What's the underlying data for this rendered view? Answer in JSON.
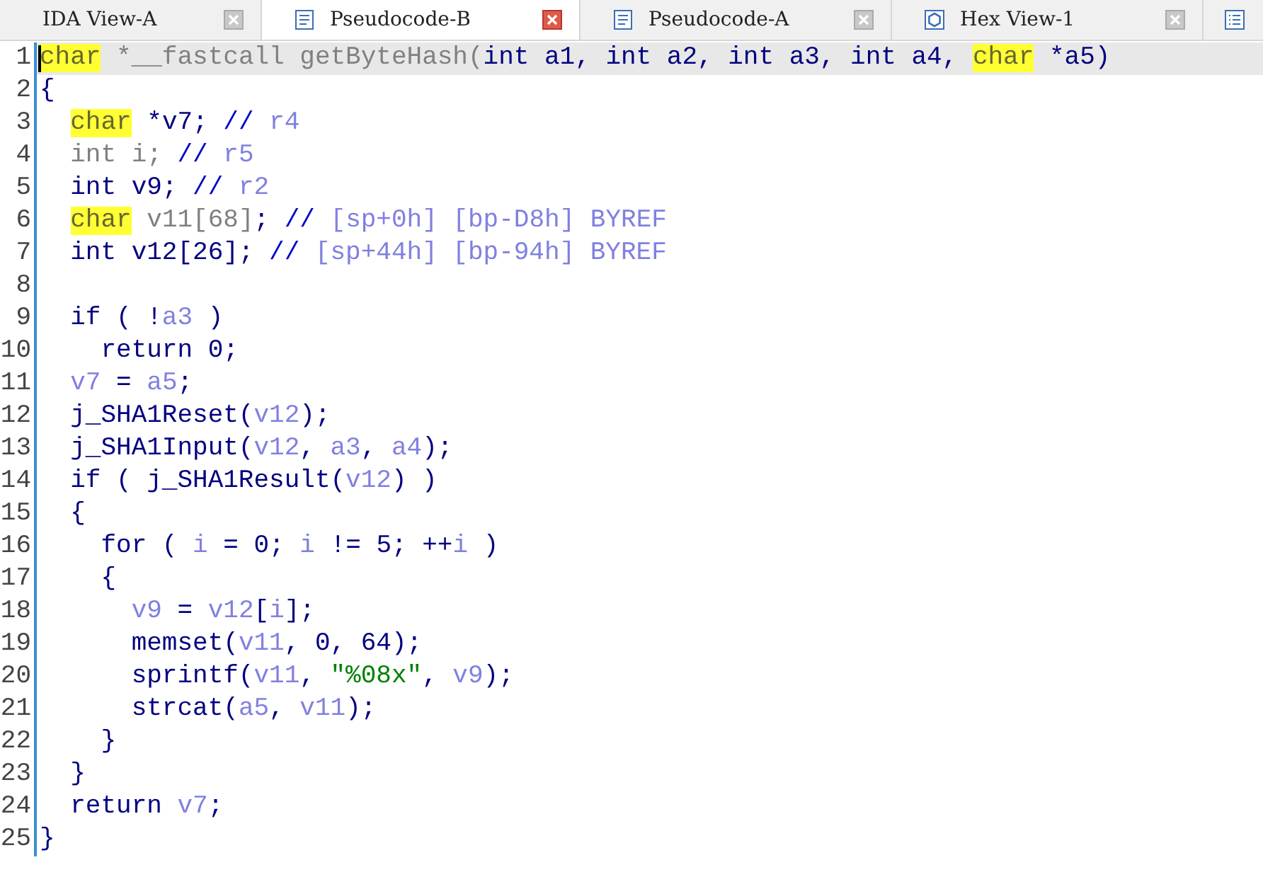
{
  "tabs": [
    {
      "label": "IDA View-A",
      "kind": "disassembly",
      "selected": false
    },
    {
      "label": "Pseudocode-B",
      "kind": "pseudocode",
      "selected": true
    },
    {
      "label": "Pseudocode-A",
      "kind": "pseudocode",
      "selected": false
    },
    {
      "label": "Hex View-1",
      "kind": "hex",
      "selected": false
    },
    {
      "kind": "structures",
      "selected": false
    }
  ],
  "lines": [
    {
      "number": "1",
      "current": true,
      "tokens": [
        {
          "text": "char",
          "kind": "highlight"
        },
        {
          "text": " *__fastcall getByteHash(",
          "kind": "dim"
        },
        {
          "text": "int a1, int a2, int a3, int a4, ",
          "kind": "code"
        },
        {
          "text": "char",
          "kind": "highlight"
        },
        {
          "text": " *a5)",
          "kind": "code"
        }
      ]
    },
    {
      "number": "2",
      "current": false,
      "tokens": [
        {
          "text": "{",
          "kind": "code"
        }
      ]
    },
    {
      "number": "3",
      "current": false,
      "tokens": [
        {
          "text": "  char",
          "kind": "highlight"
        },
        {
          "text": " *v7; ",
          "kind": "code"
        },
        {
          "text": "// ",
          "kind": "comment"
        },
        {
          "text": "r4",
          "kind": "var"
        }
      ]
    },
    {
      "number": "4",
      "current": false,
      "tokens": [
        {
          "text": "  int i; ",
          "kind": "dim"
        },
        {
          "text": "// ",
          "kind": "comment"
        },
        {
          "text": "r5",
          "kind": "var"
        }
      ]
    },
    {
      "number": "5",
      "current": false,
      "tokens": [
        {
          "text": "  int v9; ",
          "kind": "code"
        },
        {
          "text": "// ",
          "kind": "comment"
        },
        {
          "text": "r2",
          "kind": "var"
        }
      ]
    },
    {
      "number": "6",
      "current": false,
      "tokens": [
        {
          "text": "  char",
          "kind": "highlight"
        },
        {
          "text": " v11[68]",
          "kind": "dim"
        },
        {
          "text": "; ",
          "kind": "code"
        },
        {
          "text": "// ",
          "kind": "comment"
        },
        {
          "text": "[sp+0h] [bp-D8h] BYREF",
          "kind": "var"
        }
      ]
    },
    {
      "number": "7",
      "current": false,
      "tokens": [
        {
          "text": "  int v12[26]; ",
          "kind": "code"
        },
        {
          "text": "// ",
          "kind": "comment"
        },
        {
          "text": "[sp+44h] [bp-94h] BYREF",
          "kind": "var"
        }
      ]
    },
    {
      "number": "8",
      "current": false
    },
    {
      "number": "9",
      "current": false,
      "tokens": [
        {
          "text": "  if ( !",
          "kind": "code"
        },
        {
          "text": "a3",
          "kind": "var"
        },
        {
          "text": " )",
          "kind": "code"
        }
      ]
    },
    {
      "number": "10",
      "current": false,
      "tokens": [
        {
          "text": "    return 0;",
          "kind": "code"
        }
      ]
    },
    {
      "number": "11",
      "current": false,
      "tokens": [
        {
          "text": "  v7",
          "kind": "var"
        },
        {
          "text": " = ",
          "kind": "code"
        },
        {
          "text": "a5",
          "kind": "var"
        },
        {
          "text": ";",
          "kind": "code"
        }
      ]
    },
    {
      "number": "12",
      "current": false,
      "tokens": [
        {
          "text": "  j_SHA1Reset(",
          "kind": "code"
        },
        {
          "text": "v12",
          "kind": "var"
        },
        {
          "text": ");",
          "kind": "code"
        }
      ]
    },
    {
      "number": "13",
      "current": false,
      "tokens": [
        {
          "text": "  j_SHA1Input(",
          "kind": "code"
        },
        {
          "text": "v12",
          "kind": "var"
        },
        {
          "text": ", ",
          "kind": "code"
        },
        {
          "text": "a3",
          "kind": "var"
        },
        {
          "text": ", ",
          "kind": "code"
        },
        {
          "text": "a4",
          "kind": "var"
        },
        {
          "text": ");",
          "kind": "code"
        }
      ]
    },
    {
      "number": "14",
      "current": false,
      "tokens": [
        {
          "text": "  if ( j_SHA1Result(",
          "kind": "code"
        },
        {
          "text": "v12",
          "kind": "var"
        },
        {
          "text": ") )",
          "kind": "code"
        }
      ]
    },
    {
      "number": "15",
      "current": false,
      "tokens": [
        {
          "text": "  {",
          "kind": "code"
        }
      ]
    },
    {
      "number": "16",
      "current": false,
      "tokens": [
        {
          "text": "    for ( ",
          "kind": "code"
        },
        {
          "text": "i",
          "kind": "var"
        },
        {
          "text": " = 0; ",
          "kind": "code"
        },
        {
          "text": "i",
          "kind": "var"
        },
        {
          "text": " != 5; ++",
          "kind": "code"
        },
        {
          "text": "i",
          "kind": "var"
        },
        {
          "text": " )",
          "kind": "code"
        }
      ]
    },
    {
      "number": "17",
      "current": false,
      "tokens": [
        {
          "text": "    {",
          "kind": "code"
        }
      ]
    },
    {
      "number": "18",
      "current": false,
      "tokens": [
        {
          "text": "      v9",
          "kind": "var"
        },
        {
          "text": " = ",
          "kind": "code"
        },
        {
          "text": "v12",
          "kind": "var"
        },
        {
          "text": "[",
          "kind": "code"
        },
        {
          "text": "i",
          "kind": "var"
        },
        {
          "text": "];",
          "kind": "code"
        }
      ]
    },
    {
      "number": "19",
      "current": false,
      "tokens": [
        {
          "text": "      memset(",
          "kind": "code"
        },
        {
          "text": "v11",
          "kind": "var"
        },
        {
          "text": ", 0, 64);",
          "kind": "code"
        }
      ]
    },
    {
      "number": "20",
      "current": false,
      "tokens": [
        {
          "text": "      sprintf(",
          "kind": "code"
        },
        {
          "text": "v11",
          "kind": "var"
        },
        {
          "text": ", ",
          "kind": "code"
        },
        {
          "text": "\"%08x\"",
          "kind": "string"
        },
        {
          "text": ", ",
          "kind": "code"
        },
        {
          "text": "v9",
          "kind": "var"
        },
        {
          "text": ");",
          "kind": "code"
        }
      ]
    },
    {
      "number": "21",
      "current": false,
      "tokens": [
        {
          "text": "      strcat(",
          "kind": "code"
        },
        {
          "text": "a5",
          "kind": "var"
        },
        {
          "text": ", ",
          "kind": "code"
        },
        {
          "text": "v11",
          "kind": "var"
        },
        {
          "text": ");",
          "kind": "code"
        }
      ]
    },
    {
      "number": "22",
      "current": false,
      "tokens": [
        {
          "text": "    }",
          "kind": "code"
        }
      ]
    },
    {
      "number": "23",
      "current": false,
      "tokens": [
        {
          "text": "  }",
          "kind": "code"
        }
      ]
    },
    {
      "number": "24",
      "current": false,
      "tokens": [
        {
          "text": "  return ",
          "kind": "code"
        },
        {
          "text": "v7",
          "kind": "var"
        },
        {
          "text": ";",
          "kind": "code"
        }
      ]
    },
    {
      "number": "25",
      "current": false,
      "tokens": [
        {
          "text": "}",
          "kind": "code"
        }
      ]
    }
  ]
}
